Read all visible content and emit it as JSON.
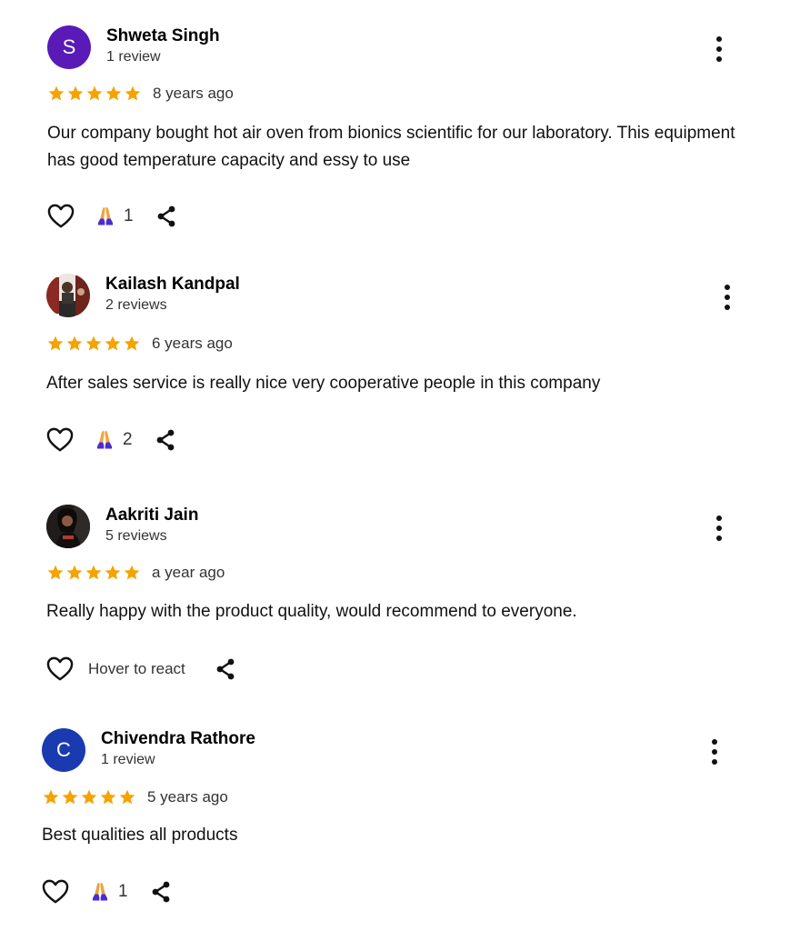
{
  "reviews": [
    {
      "name": "Shweta Singh",
      "review_count": "1 review",
      "avatar_letter": "S",
      "avatar_color": "#5a1ab8",
      "avatar_type": "letter",
      "stars": 5,
      "date": "8 years ago",
      "text": "Our company bought hot air oven from bionics scientific for our laboratory. This equipment has good temperature capacity and essy to use",
      "reaction_count": "1"
    },
    {
      "name": "Kailash Kandpal",
      "review_count": "2 reviews",
      "avatar_type": "photo",
      "stars": 5,
      "date": "6 years ago",
      "text": "After sales service is really nice very cooperative people in this company",
      "reaction_count": "2"
    },
    {
      "name": "Aakriti Jain",
      "review_count": "5 reviews",
      "avatar_type": "photo",
      "stars": 5,
      "date": "a year ago",
      "text": "Really happy with the product quality, would recommend to everyone.",
      "hover_label": "Hover to react"
    },
    {
      "name": "Chivendra Rathore",
      "review_count": "1 review",
      "avatar_letter": "C",
      "avatar_color": "#1a3ab0",
      "avatar_type": "letter",
      "stars": 5,
      "date": "5 years ago",
      "text": "Best qualities all products",
      "reaction_count": "1"
    }
  ],
  "colors": {
    "star": "#f5a300",
    "text": "#111111",
    "secondary": "#333333",
    "react_orange": "#f2a23a",
    "react_purple": "#4b2bd6"
  },
  "icons": {
    "like": "heart-icon",
    "reaction": "praying-hands-icon",
    "share": "share-icon",
    "menu": "more-vertical-icon",
    "rating": "star-icon"
  }
}
